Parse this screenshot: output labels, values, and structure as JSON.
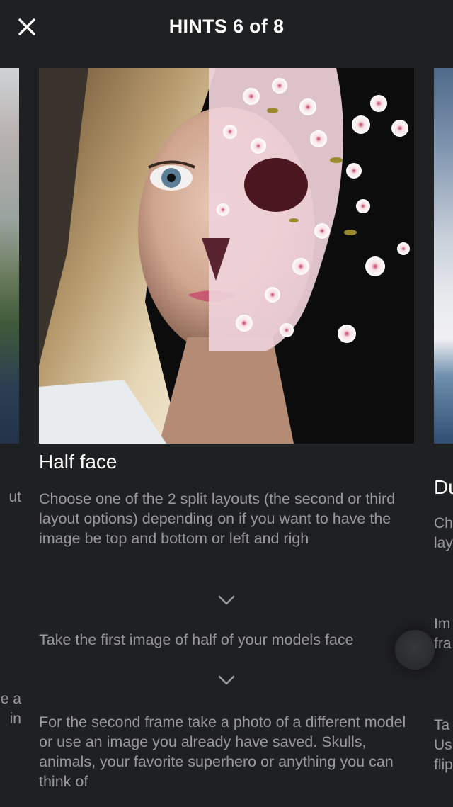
{
  "header": {
    "close_icon": "close-icon",
    "title": "HINTS 6 of 8"
  },
  "card": {
    "title": "Half face",
    "image_icon": "half-face-skull-photo",
    "steps": [
      "Choose one of the 2 split layouts (the second or third layout options) depending on if you want to have the image be top and bottom or left and righ",
      "Take the first image of half of your models face",
      "For the second frame take a photo of a different model or use an image you already have saved. Skulls, animals, your favorite superhero or anything you can think of"
    ],
    "chevron_icon": "chevron-down-icon"
  },
  "left_card": {
    "fragments": [
      "ut",
      "e a",
      "in"
    ]
  },
  "right_card": {
    "title_fragment": "Du",
    "fragments": [
      "Ch",
      "lay",
      "Im",
      "fra",
      "Ta",
      "Us",
      "flip"
    ]
  },
  "colors": {
    "background": "#1f2022",
    "title_text": "#ffffff",
    "body_text": "#9a9a9d"
  }
}
